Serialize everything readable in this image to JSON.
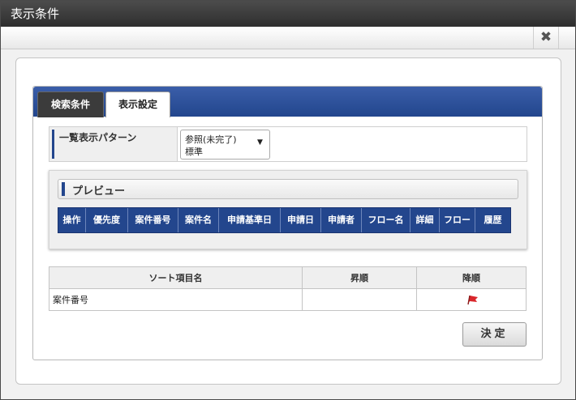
{
  "window": {
    "title": "表示条件",
    "close_label": "✖"
  },
  "tabs": [
    {
      "label": "検索条件",
      "active": false
    },
    {
      "label": "表示設定",
      "active": true
    }
  ],
  "pattern": {
    "label": "一覧表示パターン",
    "select_line1": "参照(未完了)",
    "select_line2": "標準"
  },
  "preview": {
    "title": "プレビュー",
    "columns": [
      "操作",
      "優先度",
      "案件番号",
      "案件名",
      "申請基準日",
      "申請日",
      "申請者",
      "フロー名",
      "詳細",
      "フロー",
      "履歴"
    ]
  },
  "sort_table": {
    "headers": [
      "ソート項目名",
      "昇順",
      "降順"
    ],
    "rows": [
      {
        "name": "案件番号",
        "asc": "",
        "desc_icon": "flag-icon"
      }
    ]
  },
  "buttons": {
    "decide": "決定"
  },
  "colors": {
    "accent": "#23468d",
    "titlebar": "#3a3a3a",
    "flag": "#d9262b"
  }
}
